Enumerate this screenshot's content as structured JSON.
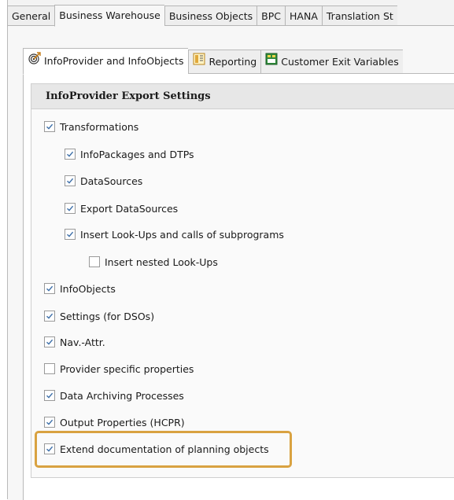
{
  "outer_tabs": [
    "General",
    "Business Warehouse",
    "Business Objects",
    "BPC",
    "HANA",
    "Translation St"
  ],
  "inner_tabs": [
    {
      "label": "InfoProvider and InfoObjects",
      "icon": "target-icon"
    },
    {
      "label": "Reporting",
      "icon": "report-icon"
    },
    {
      "label": "Customer Exit Variables",
      "icon": "variable-icon"
    }
  ],
  "settings": {
    "title": "InfoProvider Export Settings",
    "items": [
      {
        "label": "Transformations",
        "checked": true
      },
      {
        "label": "InfoPackages and DTPs",
        "checked": true
      },
      {
        "label": "DataSources",
        "checked": true
      },
      {
        "label": "Export DataSources",
        "checked": true
      },
      {
        "label": "Insert Look-Ups and calls of subprograms",
        "checked": true
      },
      {
        "label": "Insert nested Look-Ups",
        "checked": false
      },
      {
        "label": "InfoObjects",
        "checked": true
      },
      {
        "label": "Settings (for DSOs)",
        "checked": true
      },
      {
        "label": "Nav.-Attr.",
        "checked": true
      },
      {
        "label": "Provider specific properties",
        "checked": false
      },
      {
        "label": "Data Archiving Processes",
        "checked": true
      },
      {
        "label": "Output Properties (HCPR)",
        "checked": true
      },
      {
        "label": "Extend documentation of planning objects",
        "checked": true
      }
    ]
  },
  "colors": {
    "highlight": "#d9a241",
    "check": "#3c6ea8"
  }
}
